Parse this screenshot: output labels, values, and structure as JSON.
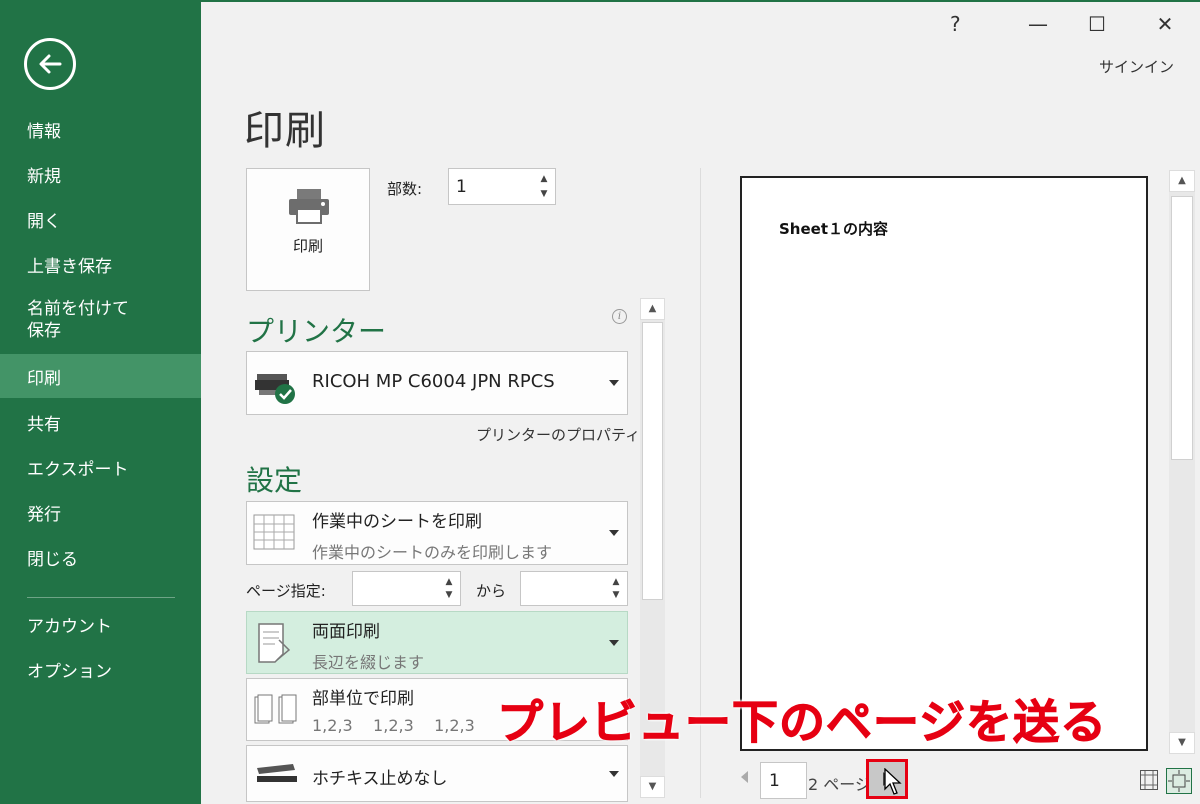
{
  "window": {
    "help": "?",
    "minimize": "—",
    "maximize": "☐",
    "close": "✕",
    "signin": "サインイン"
  },
  "sidebar": {
    "items": [
      {
        "label": "情報"
      },
      {
        "label": "新規"
      },
      {
        "label": "開く"
      },
      {
        "label": "上書き保存"
      },
      {
        "label": "名前を付けて\n保存"
      },
      {
        "label": "印刷",
        "active": true
      },
      {
        "label": "共有"
      },
      {
        "label": "エクスポート"
      },
      {
        "label": "発行"
      },
      {
        "label": "閉じる"
      },
      {
        "label": "アカウント"
      },
      {
        "label": "オプション"
      }
    ]
  },
  "page_title": "印刷",
  "print_button": {
    "label": "印刷"
  },
  "copies": {
    "label": "部数:",
    "value": "1"
  },
  "printer": {
    "heading": "プリンター",
    "selected": "RICOH MP C6004 JPN RPCS",
    "properties_link": "プリンターのプロパティ"
  },
  "settings": {
    "heading": "設定",
    "print_what": {
      "title": "作業中のシートを印刷",
      "subtitle": "作業中のシートのみを印刷します"
    },
    "pages": {
      "label": "ページ指定:",
      "from": "",
      "to_label": "から",
      "to": ""
    },
    "duplex": {
      "title": "両面印刷",
      "subtitle": "長辺を綴じます"
    },
    "collate": {
      "title": "部単位で印刷",
      "subtitle": "1,2,3    1,2,3    1,2,3"
    },
    "staple": {
      "title": "ホチキス止めなし"
    }
  },
  "preview": {
    "content_text": "Sheet１の内容",
    "current_page": "1",
    "total_pages": "2 ページ"
  },
  "annotation": "プレビュー下のページを送る",
  "colors": {
    "accent": "#217346",
    "active_nav": "#439467",
    "highlight": "#d4eedf",
    "callout": "#e60012"
  }
}
